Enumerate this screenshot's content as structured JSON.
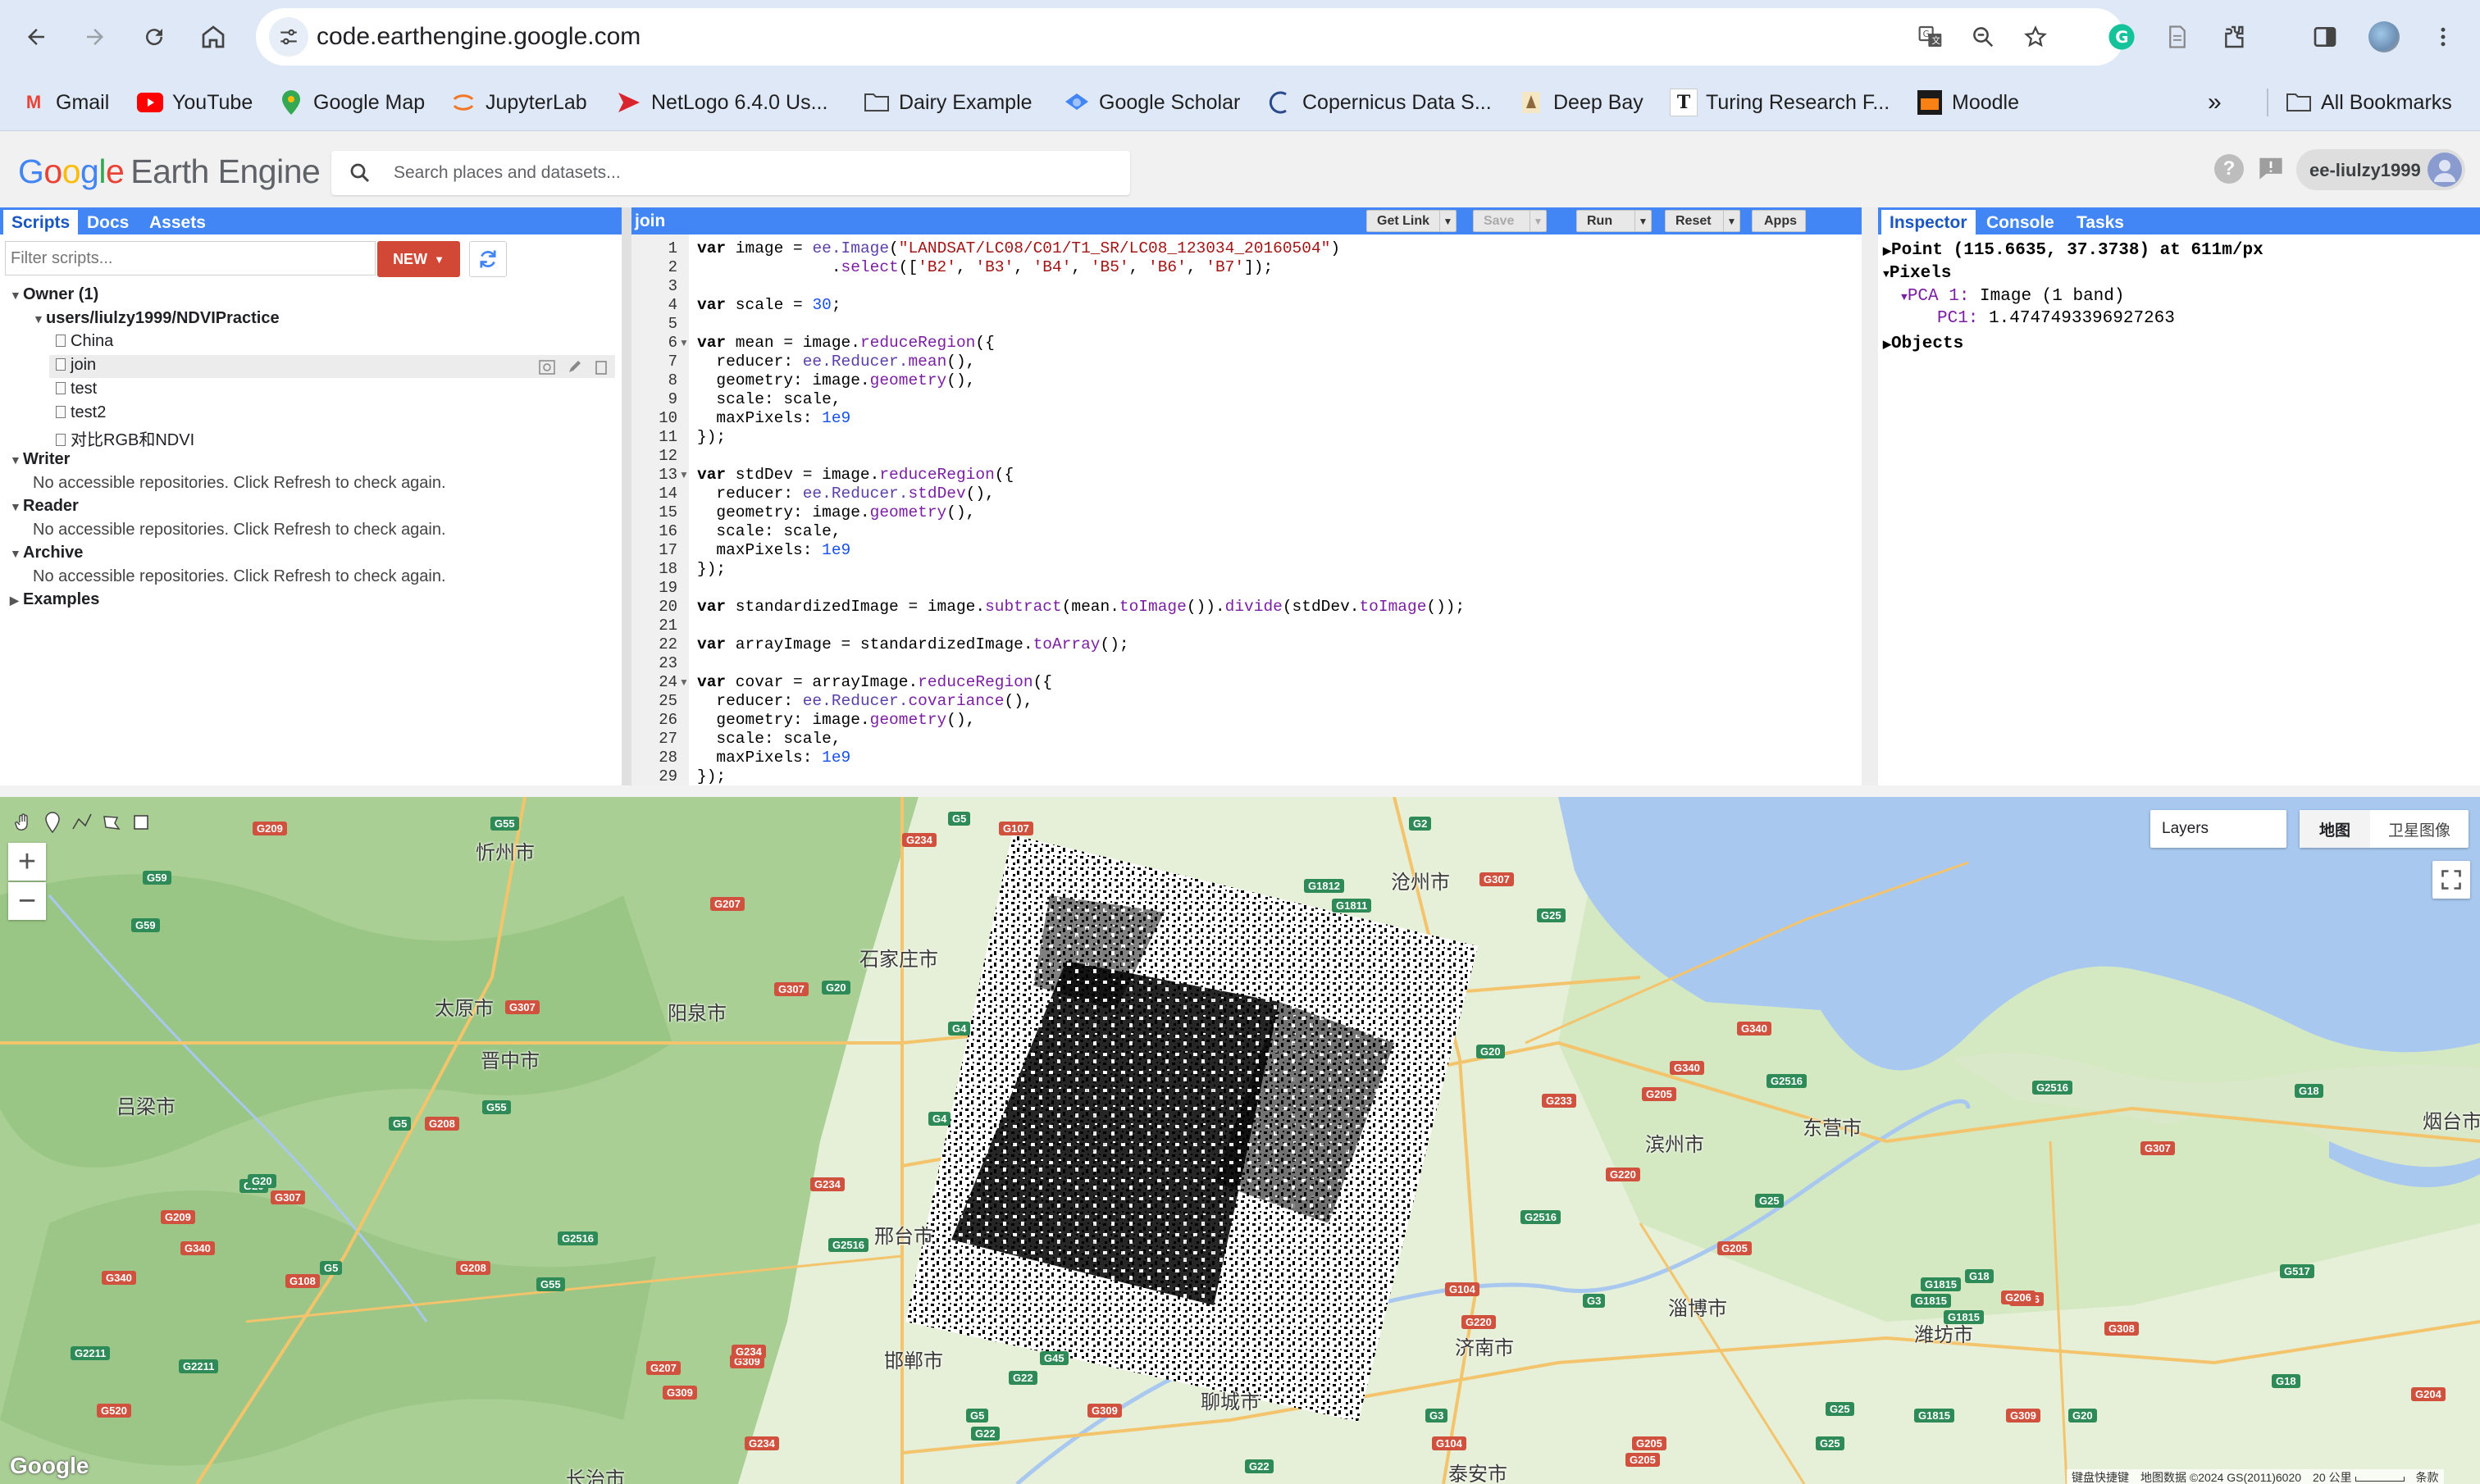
{
  "browser": {
    "url": "code.earthengine.google.com",
    "bookmarks": [
      "Gmail",
      "YouTube",
      "Google Map",
      "JupyterLab",
      "NetLogo 6.4.0 Us...",
      "Dairy Example",
      "Google Scholar",
      "Copernicus Data S...",
      "Deep Bay",
      "Turing Research F...",
      "Moodle"
    ],
    "all_bookmarks": "All Bookmarks",
    "more": "»"
  },
  "header": {
    "logo": {
      "g1": "G",
      "o1": "o",
      "o2": "o",
      "g2": "g",
      "l": "l",
      "e": "e",
      "suffix": "Earth Engine"
    },
    "search_placeholder": "Search places and datasets...",
    "user": "ee-liulzy1999"
  },
  "left_panel": {
    "tabs": [
      "Scripts",
      "Docs",
      "Assets"
    ],
    "filter_placeholder": "Filter scripts...",
    "new_label": "NEW",
    "owner_label": "Owner (1)",
    "repo": "users/liulzy1999/NDVIPractice",
    "files": [
      "China",
      "join",
      "test",
      "test2",
      "对比RGB和NDVI"
    ],
    "sections": [
      {
        "label": "Writer",
        "msg": "No accessible repositories. Click Refresh to check again."
      },
      {
        "label": "Reader",
        "msg": "No accessible repositories. Click Refresh to check again."
      },
      {
        "label": "Archive",
        "msg": "No accessible repositories. Click Refresh to check again."
      }
    ],
    "examples": "Examples"
  },
  "editor": {
    "title": "join",
    "buttons": {
      "get_link": "Get Link",
      "save": "Save",
      "run": "Run",
      "reset": "Reset",
      "apps": "Apps"
    },
    "line_count": 29,
    "code": {
      "l1a": "var",
      "l1b": " image = ",
      "l1c": "ee.Image",
      "l1d": "(",
      "l1e": "\"LANDSAT/LC08/C01/T1_SR/LC08_123034_20160504\"",
      "l1f": ")",
      "l2a": "              .",
      "l2b": "select",
      "l2c": "([",
      "l2d": "'B2'",
      "l2e": ", ",
      "l2f": "'B3'",
      "l2g": ", ",
      "l2h": "'B4'",
      "l2i": ", ",
      "l2j": "'B5'",
      "l2k": ", ",
      "l2l": "'B6'",
      "l2m": ", ",
      "l2n": "'B7'",
      "l2o": "]);",
      "l4a": "var",
      "l4b": " scale = ",
      "l4c": "30",
      "l4d": ";",
      "l6a": "var",
      "l6b": " mean = image.",
      "l6c": "reduceRegion",
      "l6d": "({",
      "l7a": "  reducer: ",
      "l7b": "ee.Reducer.",
      "l7c": "mean",
      "l7d": "(),",
      "l8a": "  geometry: image.",
      "l8b": "geometry",
      "l8c": "(),",
      "l9": "  scale: scale,",
      "l10a": "  maxPixels: ",
      "l10b": "1e9",
      "l11": "});",
      "l13a": "var",
      "l13b": " stdDev = image.",
      "l13c": "reduceRegion",
      "l13d": "({",
      "l14a": "  reducer: ",
      "l14b": "ee.Reducer.",
      "l14c": "stdDev",
      "l14d": "(),",
      "l15a": "  geometry: image.",
      "l15b": "geometry",
      "l15c": "(),",
      "l16": "  scale: scale,",
      "l17a": "  maxPixels: ",
      "l17b": "1e9",
      "l18": "});",
      "l20a": "var",
      "l20b": " standardizedImage = image.",
      "l20c": "subtract",
      "l20d": "(mean.",
      "l20e": "toImage",
      "l20f": "()).",
      "l20g": "divide",
      "l20h": "(stdDev.",
      "l20i": "toImage",
      "l20j": "());",
      "l22a": "var",
      "l22b": " arrayImage = standardizedImage.",
      "l22c": "toArray",
      "l22d": "();",
      "l24a": "var",
      "l24b": " covar = arrayImage.",
      "l24c": "reduceRegion",
      "l24d": "({",
      "l25a": "  reducer: ",
      "l25b": "ee.Reducer.",
      "l25c": "covariance",
      "l25d": "(),",
      "l26a": "  geometry: image.",
      "l26b": "geometry",
      "l26c": "(),",
      "l27": "  scale: scale,",
      "l28a": "  maxPixels: ",
      "l28b": "1e9",
      "l29": "});"
    }
  },
  "inspector": {
    "tabs": [
      "Inspector",
      "Console",
      "Tasks"
    ],
    "point": "Point (115.6635, 37.3738) at 611m/px",
    "pixels": "Pixels",
    "layer": "PCA 1:",
    "layer_desc": "Image (1 band)",
    "band": "PC1:",
    "band_value": "1.4747493396927263",
    "objects": "Objects"
  },
  "map": {
    "layers_label": "Layers",
    "map_type": "地图",
    "satellite": "卫星图像",
    "watermark": "Google",
    "attribution": [
      "键盘快捷键",
      "地图数据 ©2024 GS(2011)6020",
      "20 公里",
      "条款"
    ],
    "cities": [
      "忻州市",
      "石家庄市",
      "沧州市",
      "太原市",
      "阳泉市",
      "晋中市",
      "吕梁市",
      "滨州市",
      "东营市",
      "烟台市",
      "邢台市",
      "邯郸市",
      "淄博市",
      "潍坊市",
      "济南市",
      "聊城市",
      "泰安市",
      "长治市"
    ],
    "shields": [
      "G209",
      "G55",
      "G5",
      "G107",
      "G2",
      "G307",
      "G1812",
      "G1811",
      "G25",
      "G207",
      "G234",
      "G59",
      "G307",
      "G20",
      "G4",
      "G307",
      "G5",
      "G208",
      "G55",
      "G20",
      "G307",
      "G340",
      "G2516",
      "G205",
      "G340",
      "G18",
      "G20",
      "G4",
      "G234",
      "G2516",
      "G205",
      "G220",
      "G25",
      "G2516",
      "G307",
      "G2516",
      "G233",
      "G1815",
      "G18",
      "G206",
      "G308",
      "G104",
      "G3",
      "G220",
      "G2211",
      "G2211",
      "G309",
      "G234",
      "G45",
      "G22",
      "G309",
      "G22",
      "G3",
      "G104",
      "G205",
      "G309",
      "G20",
      "G1815",
      "G25",
      "G22",
      "G234",
      "G2516",
      "G5",
      "G208",
      "G59",
      "G340",
      "G108",
      "G20",
      "G209",
      "G340",
      "G55",
      "G309",
      "G207",
      "G1815",
      "G517",
      "G204",
      "G206",
      "G520",
      "G25",
      "G5",
      "G18",
      "G1815",
      "G205"
    ]
  },
  "colors": {
    "accent": "#4285f4",
    "new_button": "#d14836",
    "chrome_bg": "#dfe8f7"
  }
}
